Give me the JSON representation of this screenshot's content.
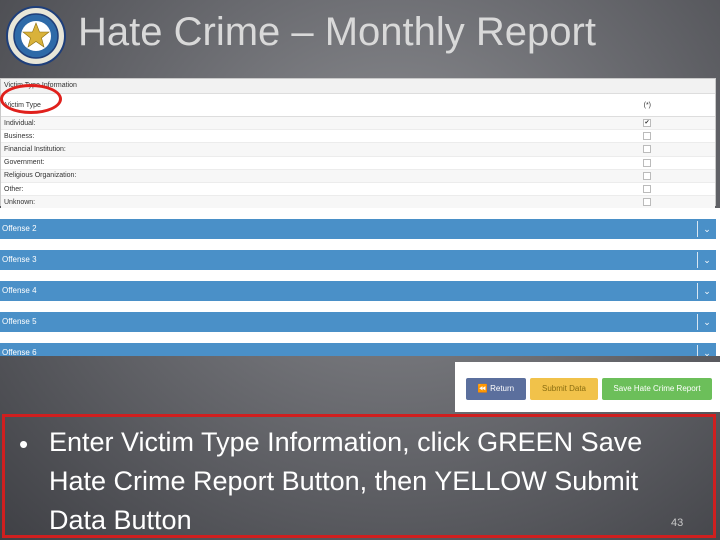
{
  "slide": {
    "title": "Hate Crime – Monthly Report",
    "page_number": "43"
  },
  "victim_panel": {
    "header": "Victim Type Information",
    "col_label": "Victim Type",
    "col_check_header": "(*)",
    "rows": [
      {
        "label": "Individual:",
        "checked": true
      },
      {
        "label": "Business:",
        "checked": false
      },
      {
        "label": "Financial Institution:",
        "checked": false
      },
      {
        "label": "Government:",
        "checked": false
      },
      {
        "label": "Religious Organization:",
        "checked": false
      },
      {
        "label": "Other:",
        "checked": false
      },
      {
        "label": "Unknown:",
        "checked": false
      }
    ]
  },
  "offenses": [
    "Offense 2",
    "Offense 3",
    "Offense 4",
    "Offense 5",
    "Offense 6"
  ],
  "buttons": {
    "return_label": "Return",
    "submit_label": "Submit Data",
    "save_label": "Save Hate Crime Report"
  },
  "instruction": "Enter Victim Type Information, click GREEN Save Hate Crime Report Button, then YELLOW Submit Data Button",
  "colors": {
    "offense_bar": "#4a90c8",
    "return_button": "#5b6f9d",
    "submit_button": "#f1c24a",
    "save_button": "#6cbf5a",
    "highlight": "#e0201c"
  }
}
